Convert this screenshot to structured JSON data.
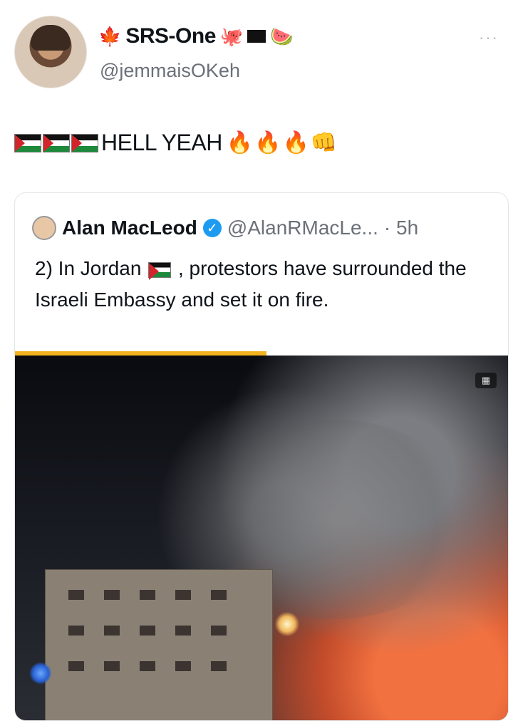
{
  "author": {
    "name": "SRS-One",
    "handle": "@jemmaisOKeh"
  },
  "post": {
    "text": "HELL YEAH"
  },
  "quoted": {
    "author_name": "Alan MacLeod",
    "author_handle": "@AlanRMacLe...",
    "time": "· 5h",
    "text_before_flag": "2) In Jordan",
    "text_after_flag": ", protestors have surrounded the Israeli Embassy and set it on fire."
  },
  "media": {
    "video_progress_fraction": 0.51
  },
  "colors": {
    "verified": "#1d9bf0",
    "progress": "#f3b21f",
    "handle": "#6b7078"
  },
  "icons": [
    "maple-leaf-icon",
    "octopus-icon",
    "black-flag-icon",
    "watermelon-icon",
    "palestine-flag-icon",
    "fire-icon",
    "fist-icon",
    "verified-badge-icon",
    "more-icon"
  ]
}
